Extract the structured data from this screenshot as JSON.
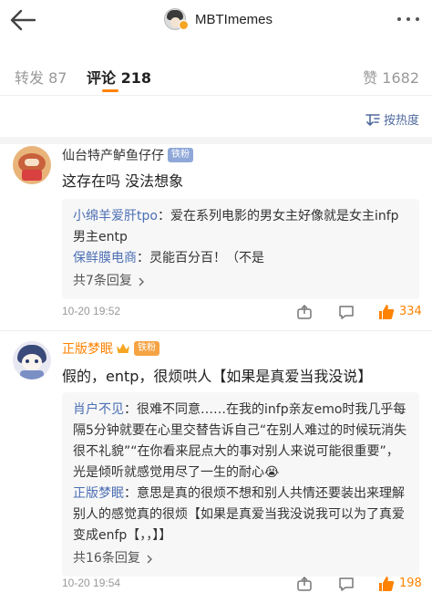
{
  "header": {
    "account_name": "MBTImemes",
    "back_icon": "back-arrow-icon",
    "more_icon": "more-dots-icon"
  },
  "tabs": {
    "repost_label": "转发",
    "repost_count": "87",
    "comment_label": "评论",
    "comment_count": "218",
    "like_label": "赞",
    "like_count": "1682",
    "active": "comment",
    "accent_color": "#ff8200"
  },
  "sort": {
    "label": "按热度",
    "icon": "sort-icon"
  },
  "comments": [
    {
      "username": "仙台特产鲈鱼仔仔",
      "badge": "铁粉",
      "text": "这存在吗 没法想象",
      "replies": [
        {
          "name": "小绵羊爱肝tpo",
          "text": "：爱在系列电影的男女主好像就是女主infp男主entp"
        },
        {
          "name": "保鲜膜电商",
          "text": "：灵能百分百！（不是"
        }
      ],
      "more_replies": "共7条回复",
      "time": "10-20 19:52",
      "likes": "334"
    },
    {
      "username": "正版梦眠",
      "badge": "铁粉",
      "text": "假的，entp，很烦哄人【如果是真爱当我没说】",
      "replies": [
        {
          "name": "肖户不见",
          "text": "：很难不同意……在我的infp亲友emo时我几乎每隔5分钟就要在心里交替告诉自己“在别人难过的时候玩消失很不礼貌”“在你看来屁点大的事对别人来说可能很重要”，光是倾听就感觉用尽了一生的耐心😭"
        },
        {
          "name": "正版梦眠",
          "text": "：意思是真的很烦不想和别人共情还要装出来理解别人的感觉真的很烦【如果是真爱当我没说我可以为了真爱变成enfp【，，】】"
        }
      ],
      "more_replies": "共16条回复",
      "time": "10-20 19:54",
      "likes": "198"
    }
  ]
}
